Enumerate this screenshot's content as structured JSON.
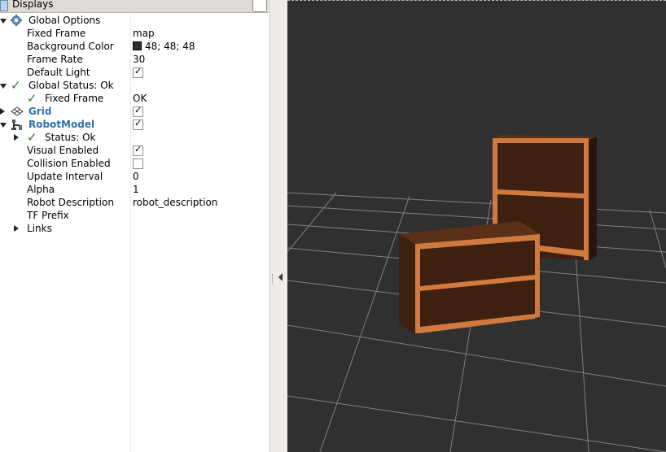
{
  "panel": {
    "title": "Displays"
  },
  "tree": {
    "global_options": {
      "label": "Global Options"
    },
    "fixed_frame": {
      "label": "Fixed Frame",
      "value": "map"
    },
    "background_color": {
      "label": "Background Color",
      "value": "48; 48; 48",
      "color": "#303030"
    },
    "frame_rate": {
      "label": "Frame Rate",
      "value": "30"
    },
    "default_light": {
      "label": "Default Light",
      "checked": true
    },
    "global_status": {
      "label": "Global Status: Ok"
    },
    "status_fixed_frame": {
      "label": "Fixed Frame",
      "value": "OK"
    },
    "grid": {
      "label": "Grid",
      "checked": true
    },
    "robot_model": {
      "label": "RobotModel",
      "checked": true
    },
    "robot_status": {
      "label": "Status: Ok"
    },
    "visual_enabled": {
      "label": "Visual Enabled",
      "checked": true
    },
    "collision_enabled": {
      "label": "Collision Enabled",
      "checked": false
    },
    "update_interval": {
      "label": "Update Interval",
      "value": "0"
    },
    "alpha": {
      "label": "Alpha",
      "value": "1"
    },
    "robot_description": {
      "label": "Robot Description",
      "value": "robot_description"
    },
    "tf_prefix": {
      "label": "TF Prefix",
      "value": ""
    },
    "links": {
      "label": "Links"
    }
  },
  "viewport": {
    "background": "#303030",
    "grid_color": "#9a9a9a",
    "wood_dark": "#3d2010",
    "wood_edge": "#d07a40"
  },
  "icons": {
    "global_options": "gear-icon",
    "ok_status": "check-icon",
    "grid": "grid-icon",
    "robot_model": "robot-icon"
  }
}
